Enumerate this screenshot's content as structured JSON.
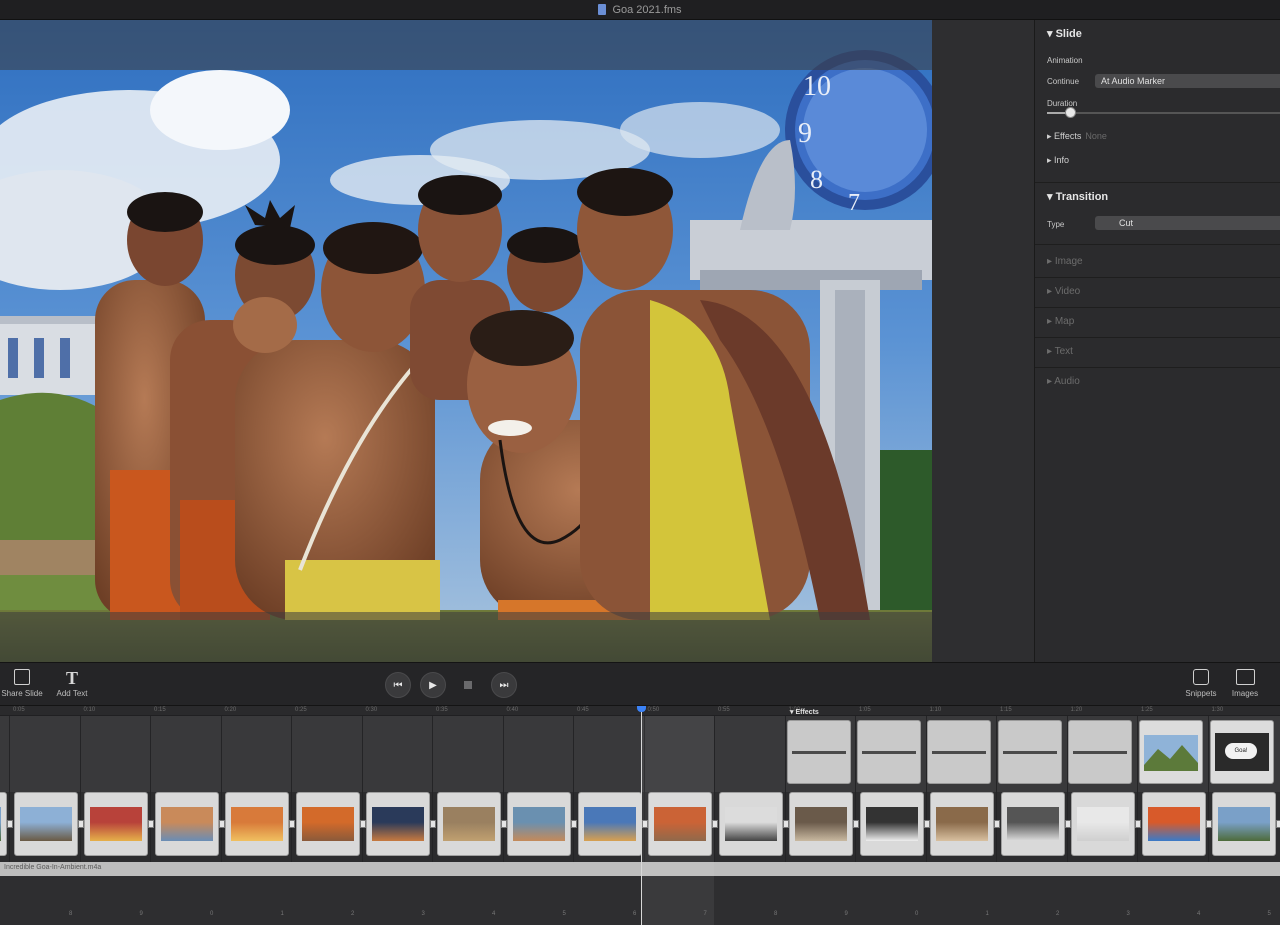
{
  "window": {
    "title": "Goa 2021.fms",
    "doc_icon": "document-icon"
  },
  "inspector": {
    "slide": {
      "header": "Slide",
      "animation_label": "Animation",
      "continue_label": "Continue",
      "continue_value": "At Audio Marker",
      "duration_label": "Duration",
      "duration_level": 0.08,
      "effects_label": "Effects",
      "effects_value": "None",
      "info_label": "Info"
    },
    "transition": {
      "header": "Transition",
      "type_label": "Type",
      "type_value": "Cut"
    },
    "collapsed_sections": [
      "Image",
      "Video",
      "Map",
      "Text",
      "Audio"
    ]
  },
  "toolbar": {
    "left_tools": [
      {
        "label": "Share Slide",
        "icon": "slide-outline-icon"
      },
      {
        "label": "Add Text",
        "icon": "text-t-icon"
      }
    ],
    "transport": {
      "rewind": "⏮",
      "play": "▶",
      "forward": "⏭"
    },
    "right_tools": [
      {
        "label": "Snippets",
        "icon": "snippets-icon"
      },
      {
        "label": "Images",
        "icon": "images-icon"
      }
    ]
  },
  "timeline": {
    "ruler_ticks": [
      "0:05",
      "0:10",
      "0:15",
      "0:20",
      "0:25",
      "0:30",
      "0:35",
      "0:40",
      "0:45",
      "0:50",
      "0:55",
      "1:00",
      "1:05",
      "1:10",
      "1:15",
      "1:20",
      "1:25",
      "1:30"
    ],
    "effects_label": "▾ Effects",
    "speech_bubble_text": "Goa!",
    "audio_track_label": "Incredible Goa-In-Ambient.m4a",
    "marker_numbers": [
      "8",
      "9",
      "0",
      "1",
      "2",
      "3",
      "4",
      "5",
      "6",
      "7",
      "8",
      "9",
      "0",
      "1",
      "2",
      "3",
      "4",
      "5"
    ],
    "colors": {
      "playhead_cap": "#3b82f6",
      "track_bg": "#2c2c2e",
      "audio_lane": "#bdbdbd"
    }
  }
}
